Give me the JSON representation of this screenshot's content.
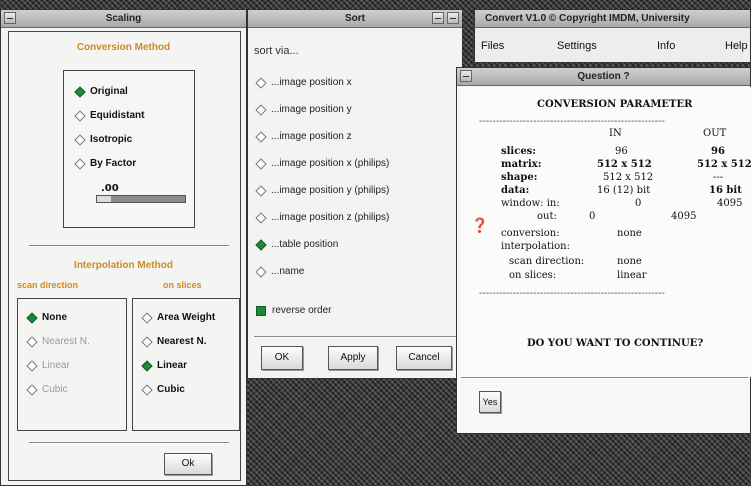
{
  "scaling": {
    "title": "Scaling",
    "conversion_heading": "Conversion Method",
    "options": [
      "Original",
      "Equidistant",
      "Isotropic",
      "By Factor"
    ],
    "selected": "Original",
    "factor_value": ".00",
    "interpolation_heading": "Interpolation Method",
    "scan_direction_label": "scan direction",
    "on_slices_label": "on slices",
    "scan_options": [
      "None",
      "Nearest N.",
      "Linear",
      "Cubic"
    ],
    "scan_selected": "None",
    "slice_options": [
      "Area Weight",
      "Nearest N.",
      "Linear",
      "Cubic"
    ],
    "slice_selected": "Linear",
    "ok_label": "Ok"
  },
  "sort": {
    "title": "Sort",
    "sort_via_label": "sort via...",
    "options": [
      "...image position x",
      "...image position y",
      "...image position z",
      "...image position x (philips)",
      "...image position y (philips)",
      "...image position z (philips)",
      "...table position",
      "...name"
    ],
    "selected": "...table position",
    "reverse_order_label": "reverse order",
    "reverse_order_checked": true,
    "ok_label": "OK",
    "apply_label": "Apply",
    "cancel_label": "Cancel"
  },
  "convert": {
    "title": "Convert V1.0   © Copyright IMDM, University",
    "menu": [
      "Files",
      "Settings",
      "Info",
      "Help"
    ]
  },
  "question": {
    "title": "Question ?",
    "heading": "CONVERSION PARAMETER",
    "col_in": "IN",
    "col_out": "OUT",
    "rows": [
      {
        "label": "slices:",
        "in": "96",
        "out": "96"
      },
      {
        "label": "matrix:",
        "in": "512 x 512",
        "out": "512 x 512"
      },
      {
        "label": "shape:",
        "in": "512 x 512",
        "out": "---"
      },
      {
        "label": "data:",
        "in": "16 (12) bit",
        "out": "16 bit"
      },
      {
        "label": "window:  in:",
        "in": "0",
        "out": "4095"
      },
      {
        "label": "out:",
        "in": "0",
        "out": "4095"
      }
    ],
    "conversion_label": "conversion:",
    "conversion_value": "none",
    "interpolation_label": "interpolation:",
    "scan_direction_label": "scan direction:",
    "scan_direction_value": "none",
    "on_slices_label": "on slices:",
    "on_slices_value": "linear",
    "dashes": "-------------------------------------------------------",
    "prompt": "DO YOU WANT TO CONTINUE?",
    "yes_label": "Yes"
  }
}
